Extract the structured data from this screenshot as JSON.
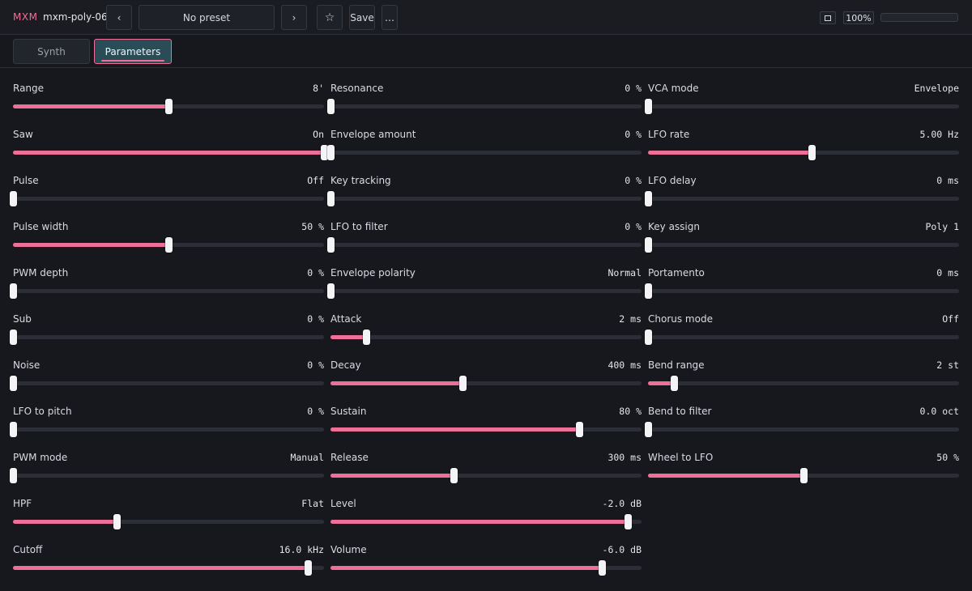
{
  "header": {
    "brand": "MXM",
    "plugin_name": "mxm-poly-06",
    "prev_label": "‹",
    "preset_label": "No preset",
    "next_label": "›",
    "star_label": "☆",
    "save_label": "Save",
    "more_label": "…",
    "zoom_label": "100%",
    "level_meter": 0
  },
  "tabs": [
    {
      "label": "Synth",
      "active": false
    },
    {
      "label": "Parameters",
      "active": true
    }
  ],
  "colors": {
    "accent": "#ee6f97",
    "active_tab": "#2a4c57",
    "background": "#16181e",
    "track": "#2b2e36"
  },
  "columns": [
    [
      {
        "name": "Range",
        "value": "8'",
        "level": 0.5
      },
      {
        "name": "Saw",
        "value": "On",
        "level": 1.0
      },
      {
        "name": "Pulse",
        "value": "Off",
        "level": 0.0
      },
      {
        "name": "Pulse width",
        "value": "50 %",
        "level": 0.5
      },
      {
        "name": "PWM depth",
        "value": "0 %",
        "level": 0.0
      },
      {
        "name": "Sub",
        "value": "0 %",
        "level": 0.0
      },
      {
        "name": "Noise",
        "value": "0 %",
        "level": 0.0
      },
      {
        "name": "LFO to pitch",
        "value": "0 %",
        "level": 0.0
      },
      {
        "name": "PWM mode",
        "value": "Manual",
        "level": 0.0
      },
      {
        "name": "HPF",
        "value": "Flat",
        "level": 0.333
      },
      {
        "name": "Cutoff",
        "value": "16.0 kHz",
        "level": 0.947
      }
    ],
    [
      {
        "name": "Resonance",
        "value": "0 %",
        "level": 0.0
      },
      {
        "name": "Envelope amount",
        "value": "0 %",
        "level": 0.0
      },
      {
        "name": "Key tracking",
        "value": "0 %",
        "level": 0.0
      },
      {
        "name": "LFO to filter",
        "value": "0 %",
        "level": 0.0
      },
      {
        "name": "Envelope polarity",
        "value": "Normal",
        "level": 0.0
      },
      {
        "name": "Attack",
        "value": "2 ms",
        "level": 0.114
      },
      {
        "name": "Decay",
        "value": "400 ms",
        "level": 0.424
      },
      {
        "name": "Sustain",
        "value": "80 %",
        "level": 0.8
      },
      {
        "name": "Release",
        "value": "300 ms",
        "level": 0.397
      },
      {
        "name": "Level",
        "value": "-2.0 dB",
        "level": 0.955
      },
      {
        "name": "Volume",
        "value": "-6.0 dB",
        "level": 0.872
      }
    ],
    [
      {
        "name": "VCA mode",
        "value": "Envelope",
        "level": 0.0
      },
      {
        "name": "LFO rate",
        "value": "5.00 Hz",
        "level": 0.527
      },
      {
        "name": "LFO delay",
        "value": "0 ms",
        "level": 0.0
      },
      {
        "name": "Key assign",
        "value": "Poly 1",
        "level": 0.0
      },
      {
        "name": "Portamento",
        "value": "0 ms",
        "level": 0.0
      },
      {
        "name": "Chorus mode",
        "value": "Off",
        "level": 0.0
      },
      {
        "name": "Bend range",
        "value": "2 st",
        "level": 0.083
      },
      {
        "name": "Bend to filter",
        "value": "0.0 oct",
        "level": 0.0
      },
      {
        "name": "Wheel to LFO",
        "value": "50 %",
        "level": 0.5
      }
    ]
  ]
}
